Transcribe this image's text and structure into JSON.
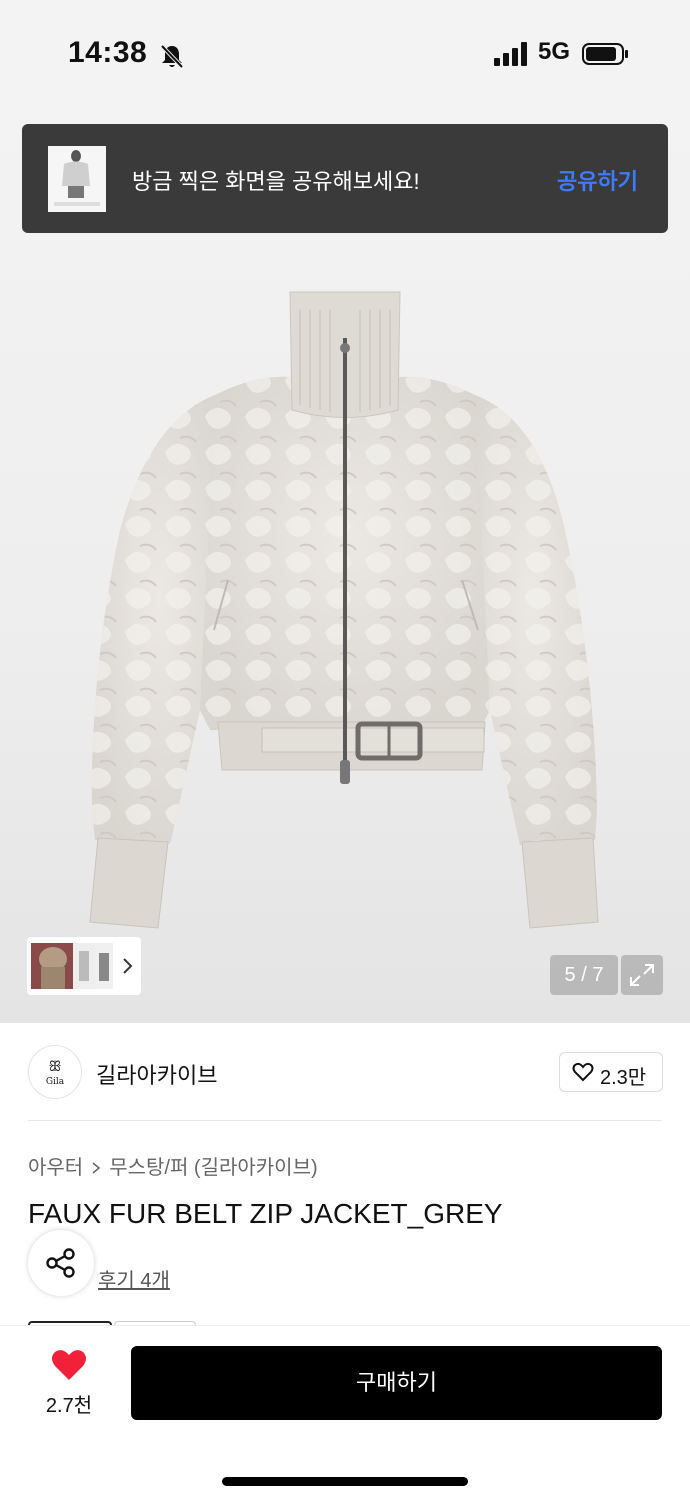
{
  "status_bar": {
    "time": "14:38",
    "network": "5G",
    "icons": [
      "bell-muted-icon",
      "signal-icon",
      "battery-icon"
    ]
  },
  "toast": {
    "message": "방금 찍은 화면을 공유해보세요!",
    "action": "공유하기",
    "action_color": "#3d7bff"
  },
  "gallery": {
    "counter": "5 / 7",
    "icons": [
      "chevron-right-icon",
      "expand-icon"
    ]
  },
  "brand": {
    "name": "길라아카이브",
    "logo_text": "Gila",
    "likes": "2.3만"
  },
  "product": {
    "breadcrumb": [
      "아우터",
      "무스탕/퍼 (길라아카이브)"
    ],
    "title": "FAUX FUR BELT ZIP JACKET_GREY",
    "reviews": "후기 4개"
  },
  "bottom": {
    "fav_count": "2.7천",
    "buy_label": "구매하기",
    "fav_color": "#f2213a"
  }
}
